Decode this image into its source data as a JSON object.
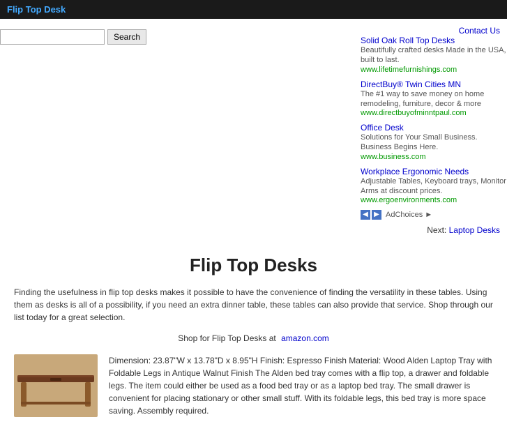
{
  "header": {
    "title": "Flip Top Desk"
  },
  "search": {
    "placeholder": "",
    "button_label": "Search"
  },
  "contact": {
    "label": "Contact Us",
    "href": "#"
  },
  "ads": [
    {
      "title": "Solid Oak Roll Top Desks",
      "desc": "Beautifully crafted desks Made in the USA, built to last.",
      "url": "www.lifetimefurnishings.com"
    },
    {
      "title": "DirectBuy® Twin Cities MN",
      "desc": "The #1 way to save money on home remodeling, furniture, decor & more",
      "url": "www.directbuyofminntpaul.com"
    },
    {
      "title": "Office Desk",
      "desc": "Solutions for Your Small Business. Business Begins Here.",
      "url": "www.business.com"
    },
    {
      "title": "Workplace Ergonomic Needs",
      "desc": "Adjustable Tables, Keyboard trays, Monitor Arms at discount prices.",
      "url": "www.ergoenvironments.com"
    }
  ],
  "ad_choices_label": "AdChoices",
  "next_label": "Next:",
  "next_link_text": "Laptop Desks",
  "page_title": "Flip Top Desks",
  "intro_text": "Finding the usefulness in flip top desks makes it possible to have the convenience of finding the versatility in these tables. Using them as desks is all of a possibility, if you need an extra dinner table, these tables can also provide that service. Shop through our list today for a great selection.",
  "shop_prefix": "Shop for Flip Top Desks at",
  "shop_link": "amazon.com",
  "product": {
    "desc": "Dimension: 23.87\"W x 13.78\"D x 8.95\"H Finish: Espresso Finish Material: Wood Alden Laptop Tray with Foldable Legs in Antique Walnut Finish The Alden bed tray comes with a flip top, a drawer and foldable legs. The item could either be used as a food bed tray or as a laptop bed tray. The small drawer is convenient for placing stationary or other small stuff. With its foldable legs, this bed tray is more space saving. Assembly required."
  }
}
